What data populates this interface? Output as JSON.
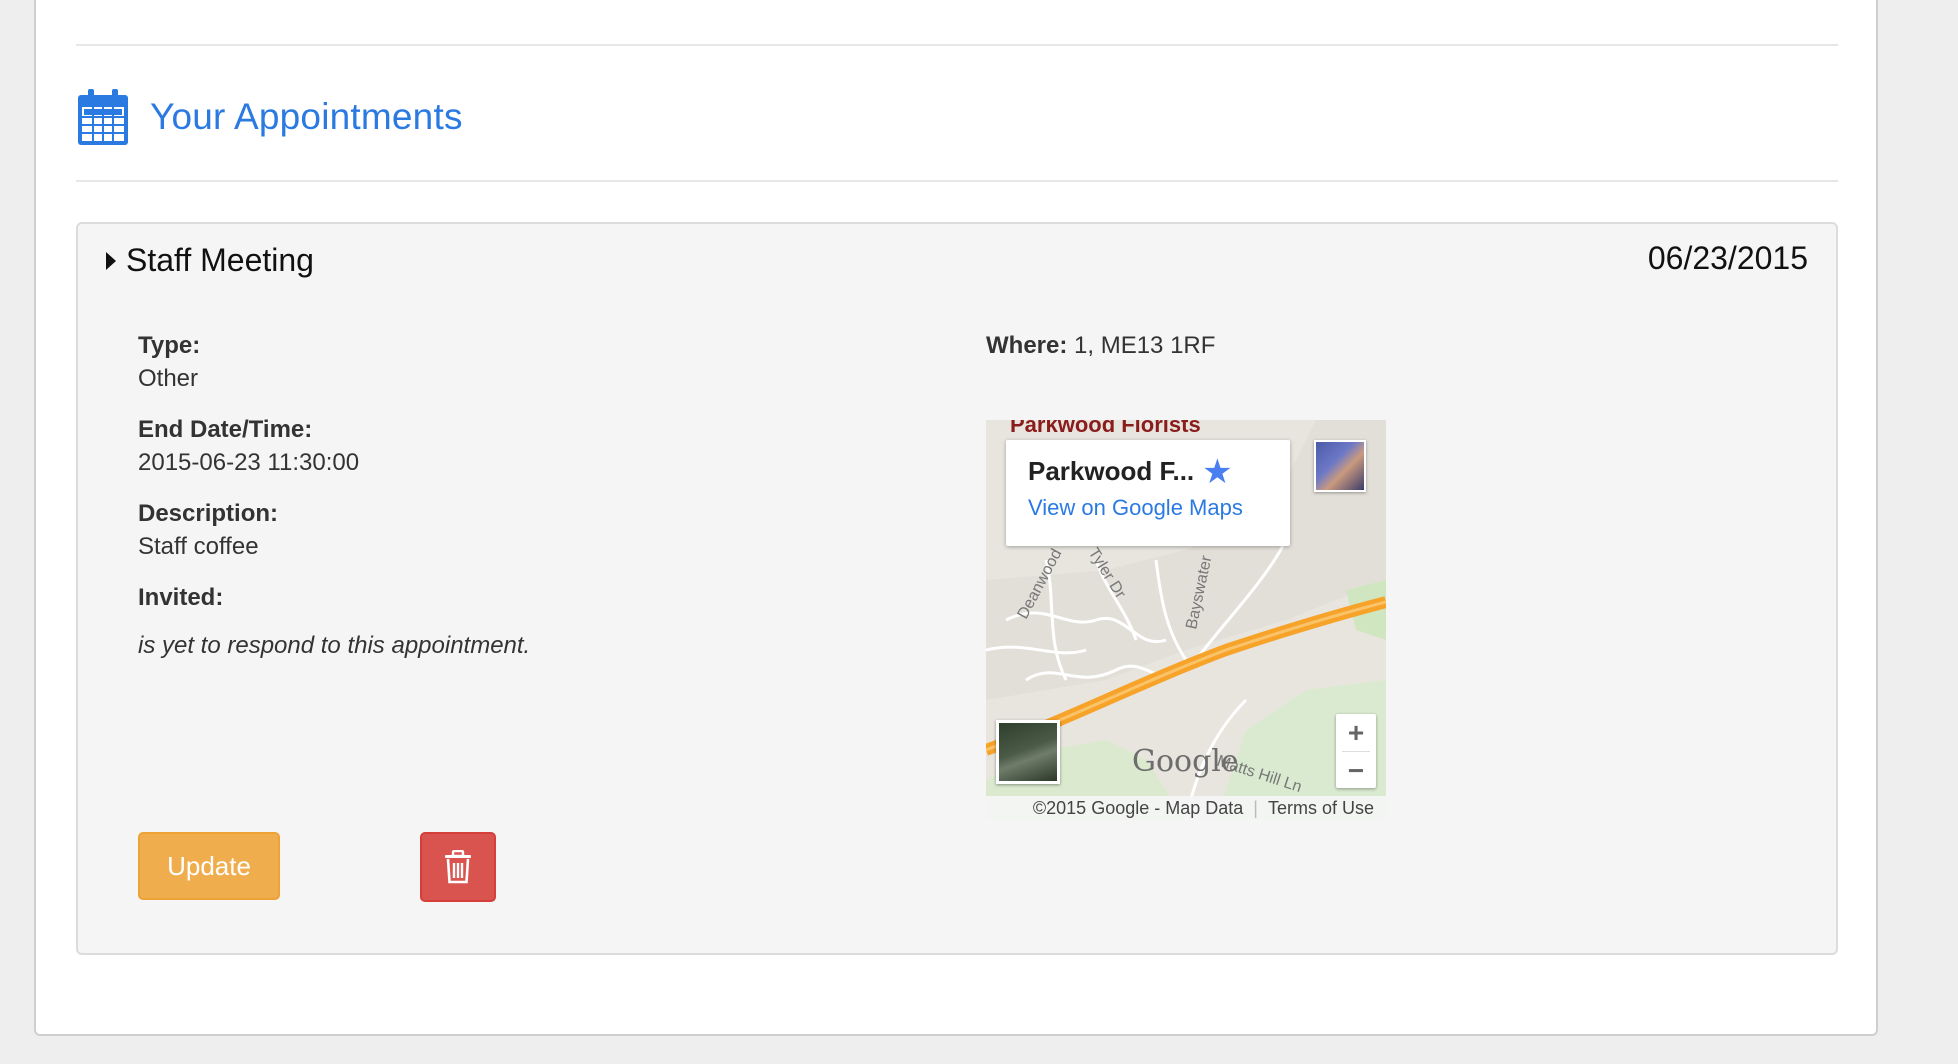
{
  "section": {
    "title": "Your Appointments",
    "icon": "calendar-icon"
  },
  "appointment": {
    "title": "Staff Meeting",
    "date": "06/23/2015",
    "fields": {
      "type_label": "Type:",
      "type_value": "Other",
      "end_label": "End Date/Time:",
      "end_value": "2015-06-23 11:30:00",
      "description_label": "Description:",
      "description_value": "Staff coffee",
      "invited_label": "Invited:",
      "invited_note": "is yet to respond to this appointment."
    },
    "where_label": "Where:",
    "where_value": "1, ME13 1RF",
    "map": {
      "top_label": "Parkwood Florists",
      "place_name": "Parkwood F...",
      "link": "View on Google Maps",
      "street_labels": [
        "Deanwood",
        "Tyler Dr",
        "Bayswater",
        "Matts Hill Ln"
      ],
      "logo": "Google",
      "copyright": "©2015 Google - Map Data",
      "terms": "Terms of Use",
      "zoom_in": "+",
      "zoom_out": "−"
    },
    "actions": {
      "update_label": "Update",
      "delete_icon": "trash-icon"
    }
  },
  "colors": {
    "accent": "#2a7ae2",
    "update": "#f0ad4e",
    "delete": "#d9534f",
    "road": "#f7a32a"
  }
}
